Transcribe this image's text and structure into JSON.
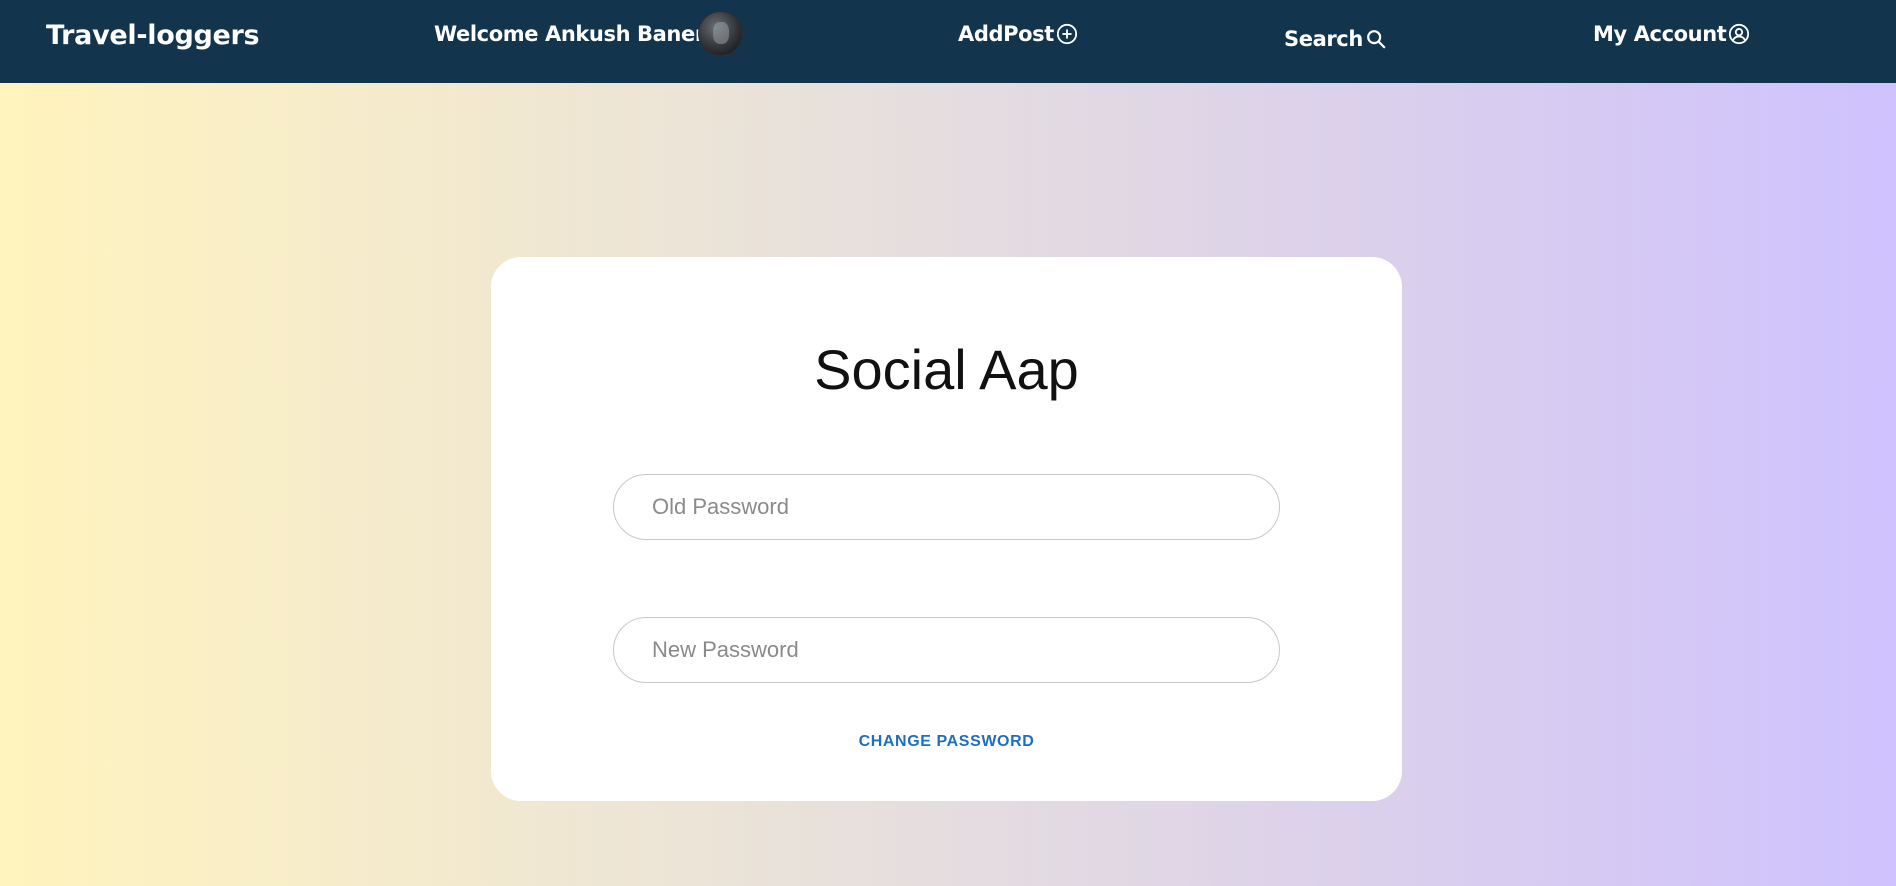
{
  "navbar": {
    "brand": "Travel-loggers",
    "welcome_text": "Welcome Ankush Banerjee",
    "addpost_label": "AddPost",
    "search_label": "Search",
    "account_label": "My Account",
    "icons": {
      "addpost": "plus-circle-icon",
      "search": "search-icon",
      "account": "user-circle-icon"
    }
  },
  "card": {
    "title": "Social Aap",
    "old_password_placeholder": "Old Password",
    "new_password_placeholder": "New Password",
    "submit_label": "CHANGE PASSWORD"
  },
  "colors": {
    "navbar_bg": "#12344d",
    "button_text": "#1f6fbf",
    "gradient_start": "#fff4bd",
    "gradient_end": "#cfc2fe"
  }
}
